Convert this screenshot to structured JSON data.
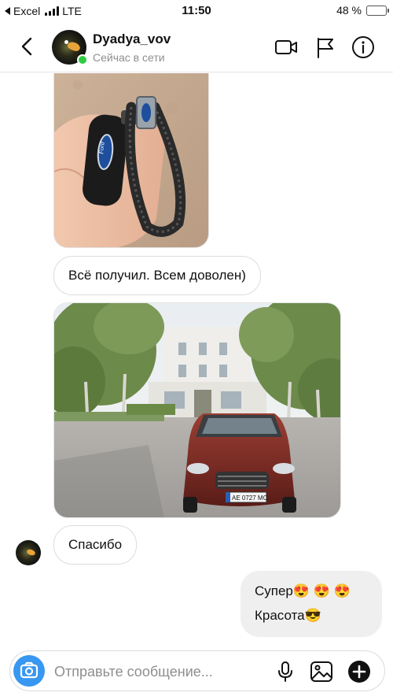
{
  "status_bar": {
    "back_app": "Excel",
    "network": "LTE",
    "time": "11:50",
    "battery": "48 %",
    "battery_level": 0.48
  },
  "header": {
    "username": "Dyadya_vov",
    "presence": "Сейчас в сети",
    "icons": [
      "chevron-left-icon",
      "video-camera-icon",
      "flag-icon",
      "info-icon"
    ]
  },
  "messages": [
    {
      "kind": "photo",
      "from": "them",
      "subject": "ford-key-fob-keychain"
    },
    {
      "kind": "text",
      "from": "them",
      "text": "Всё получил. Всем доволен)"
    },
    {
      "kind": "photo",
      "from": "them",
      "subject": "red-ford-car"
    },
    {
      "kind": "text",
      "from": "them",
      "text": "Спасибо"
    },
    {
      "kind": "text",
      "from": "me",
      "line1": "Супер😍 😍 😍",
      "line2": "Красота😎"
    }
  ],
  "photo_text": {
    "key_brand": "Ford",
    "plate": "AE 0727 MC"
  },
  "composer": {
    "placeholder": "Отправьте сообщение...",
    "icons": [
      "camera-icon",
      "microphone-icon",
      "gallery-icon",
      "plus-icon"
    ]
  },
  "colors": {
    "accent": "#3897f0",
    "online": "#2ecc40",
    "outgoing_bubble": "#efefef",
    "car_body": "#7a2a22"
  }
}
